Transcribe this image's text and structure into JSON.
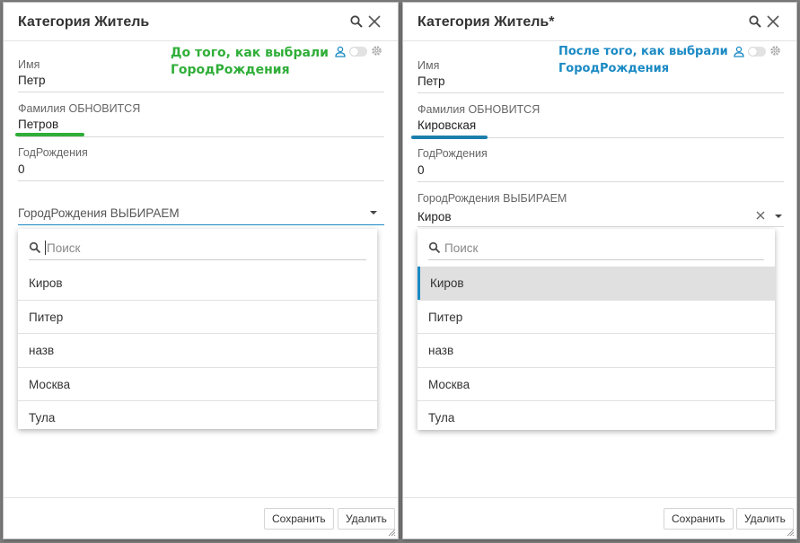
{
  "colors": {
    "accent": "#1b8ac4",
    "annotation_green": "#2fae38",
    "annotation_blue": "#1b8ac4"
  },
  "left": {
    "title": "Категория Житель",
    "annotation": [
      "До того, как выбрали",
      "ГородРождения"
    ],
    "fields": {
      "name": {
        "label": "Имя",
        "value": "Петр"
      },
      "surname": {
        "label": "Фамилия ОБНОВИТСЯ",
        "value": "Петров"
      },
      "year": {
        "label": "ГодРождения",
        "value": "0"
      },
      "city": {
        "label": "ГородРождения ВЫБИРАЕМ",
        "value": ""
      }
    },
    "dropdown": {
      "search_placeholder": "Поиск",
      "options": [
        "Киров",
        "Питер",
        "назв",
        "Москва",
        "Тула"
      ]
    },
    "buttons": {
      "save": "Сохранить",
      "delete": "Удалить"
    }
  },
  "right": {
    "title": "Категория Житель*",
    "annotation": [
      "После того, как выбрали",
      "ГородРождения"
    ],
    "fields": {
      "name": {
        "label": "Имя",
        "value": "Петр"
      },
      "surname": {
        "label": "Фамилия ОБНОВИТСЯ",
        "value": "Кировская"
      },
      "year": {
        "label": "ГодРождения",
        "value": "0"
      },
      "city": {
        "label": "ГородРождения ВЫБИРАЕМ",
        "value": "Киров"
      }
    },
    "dropdown": {
      "search_placeholder": "Поиск",
      "options": [
        "Киров",
        "Питер",
        "назв",
        "Москва",
        "Тула"
      ],
      "selected": "Киров"
    },
    "buttons": {
      "save": "Сохранить",
      "delete": "Удалить"
    }
  }
}
